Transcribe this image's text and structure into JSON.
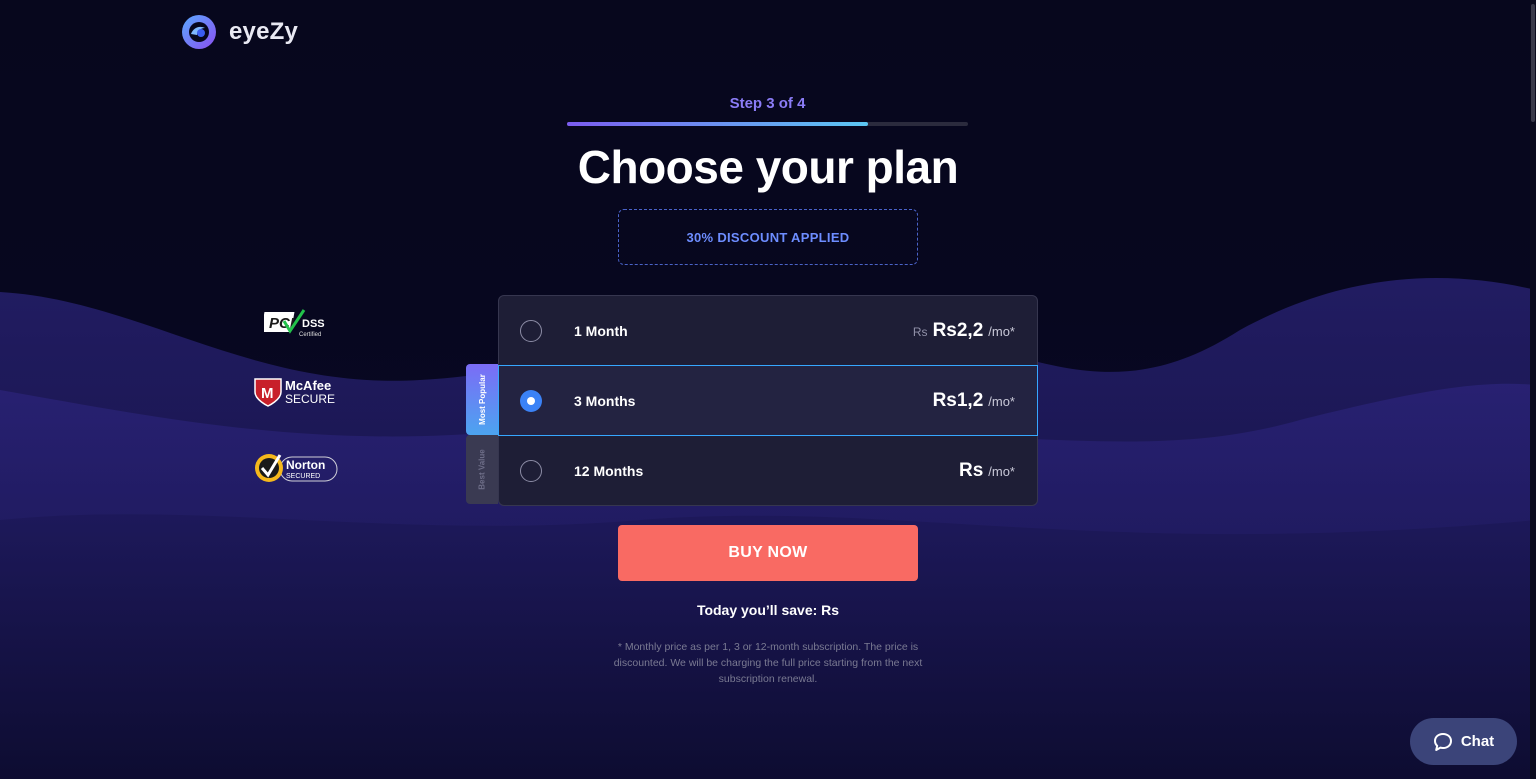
{
  "brand": {
    "name": "eyeZy"
  },
  "step": {
    "label": "Step 3 of 4",
    "progress": 0.75
  },
  "title": "Choose your plan",
  "discount_banner": "30% DISCOUNT APPLIED",
  "badges": {
    "pci": {
      "main": "PCI",
      "line1": "DSS",
      "line2": "Certified"
    },
    "mcafee": {
      "line1": "McAfee",
      "line2": "SECURE"
    },
    "norton": {
      "line1": "Norton",
      "line2": "SECURED"
    }
  },
  "plans": [
    {
      "label": "1 Month",
      "old_price": "Rs",
      "price": "Rs2,2",
      "unit": "/mo*",
      "selected": false,
      "tag": ""
    },
    {
      "label": "3 Months",
      "old_price": "",
      "price": "Rs1,2",
      "unit": "/mo*",
      "selected": true,
      "tag": "Most Popular"
    },
    {
      "label": "12 Months",
      "old_price": "",
      "price": "Rs",
      "unit": "/mo*",
      "selected": false,
      "tag": "Best Value"
    }
  ],
  "tags": {
    "popular": "Most Popular",
    "value": "Best Value"
  },
  "buy_button": "BUY NOW",
  "savings": "Today you’ll save: Rs",
  "footnote": "* Monthly price as per 1, 3 or 12-month subscription. The price is discounted. We will be charging the full price starting from the next subscription renewal.",
  "chat": {
    "label": "Chat",
    "icon": "chat-bubble-icon"
  },
  "colors": {
    "background": "#07071d",
    "accent_purple": "#8b7cf6",
    "accent_blue": "#36a7ff",
    "buy_button": "#f96a63",
    "chat_button": "#3b4479"
  }
}
